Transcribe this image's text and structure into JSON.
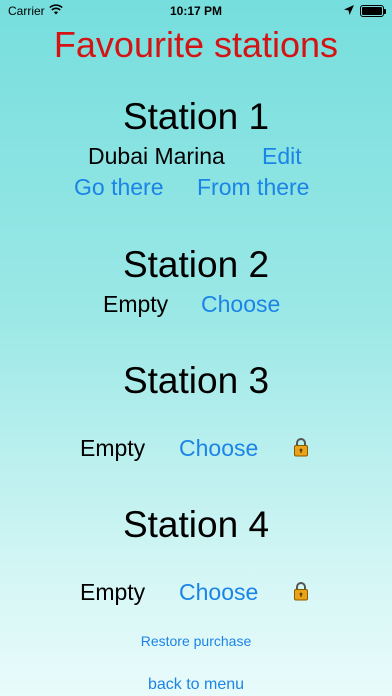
{
  "status": {
    "carrier": "Carrier",
    "time": "10:17 PM",
    "battery_level": 1.0
  },
  "title": "Favourite stations",
  "stations": [
    {
      "heading": "Station 1",
      "name": "Dubai Marina",
      "edit_label": "Edit",
      "go_there_label": "Go there",
      "from_there_label": "From there"
    },
    {
      "heading": "Station 2",
      "name": "Empty",
      "choose_label": "Choose"
    },
    {
      "heading": "Station 3",
      "name": "Empty",
      "choose_label": "Choose",
      "locked": true
    },
    {
      "heading": "Station 4",
      "name": "Empty",
      "choose_label": "Choose",
      "locked": true
    }
  ],
  "restore_purchase_label": "Restore purchase",
  "back_to_menu_label": "back to menu",
  "colors": {
    "title": "#d41414",
    "link": "#1b84e6",
    "lock": "#e8a317"
  },
  "icons": {
    "wifi": "wifi-icon",
    "location": "location-arrow-icon",
    "battery": "battery-icon",
    "lock": "padlock-icon"
  }
}
